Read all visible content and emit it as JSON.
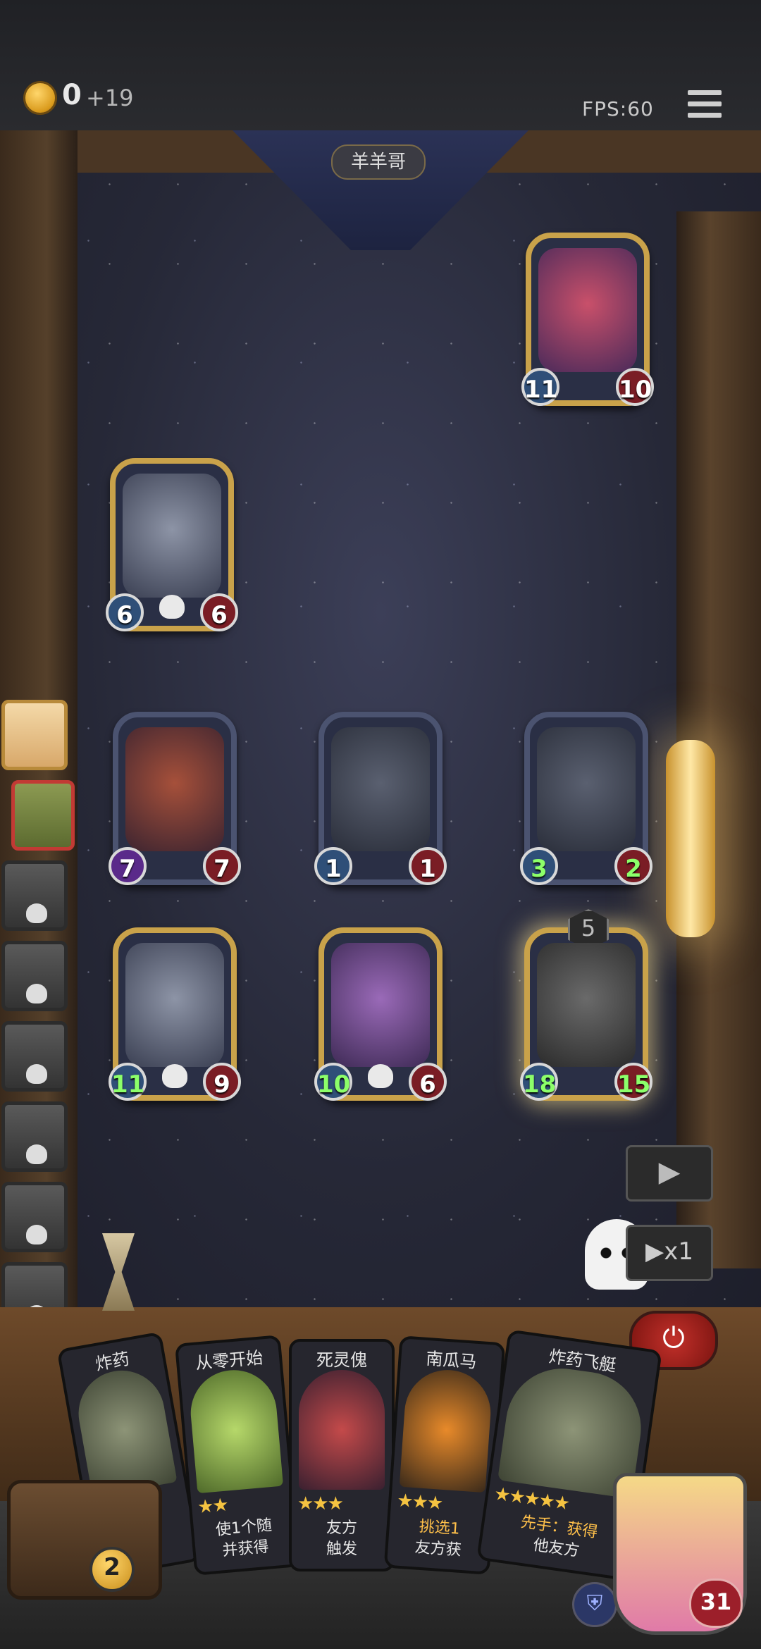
{
  "header": {
    "gold": "0",
    "gold_income": "+19",
    "fps": "FPS:60"
  },
  "opponent": {
    "name": "羊羊哥"
  },
  "board": {
    "opponent_minions": [
      {
        "atk": "11",
        "hp": "10"
      }
    ],
    "enemy_side": [
      {
        "atk": "6",
        "hp": "6"
      }
    ],
    "player_row1": [
      {
        "atk": "7",
        "hp": "7"
      },
      {
        "atk": "1",
        "hp": "1"
      },
      {
        "atk": "3",
        "hp": "2"
      }
    ],
    "player_row2": [
      {
        "atk": "11",
        "hp": "9"
      },
      {
        "atk": "10",
        "hp": "6"
      },
      {
        "atk": "18",
        "hp": "15",
        "tier": "5"
      }
    ]
  },
  "controls": {
    "play": "▶",
    "speed": "▶x1",
    "power": "⏻"
  },
  "hand": [
    {
      "name": "炸药",
      "stars": "★★★",
      "desc1": "",
      "desc2": ""
    },
    {
      "name": "从零开始",
      "stars": "★★",
      "desc1": "使1个随",
      "desc2": "并获得"
    },
    {
      "name": "死灵傀",
      "stars": "★★★",
      "desc1": "友方",
      "desc2": "触发"
    },
    {
      "name": "南瓜马",
      "stars": "★★★",
      "desc1": "挑选1",
      "desc2": "友方获"
    },
    {
      "name": "炸药飞艇",
      "stars": "★★★★★",
      "desc1": "先手：获得",
      "desc2": "他友方"
    }
  ],
  "player": {
    "coins": "2",
    "health": "31",
    "armor_icon": "shield-icon"
  }
}
